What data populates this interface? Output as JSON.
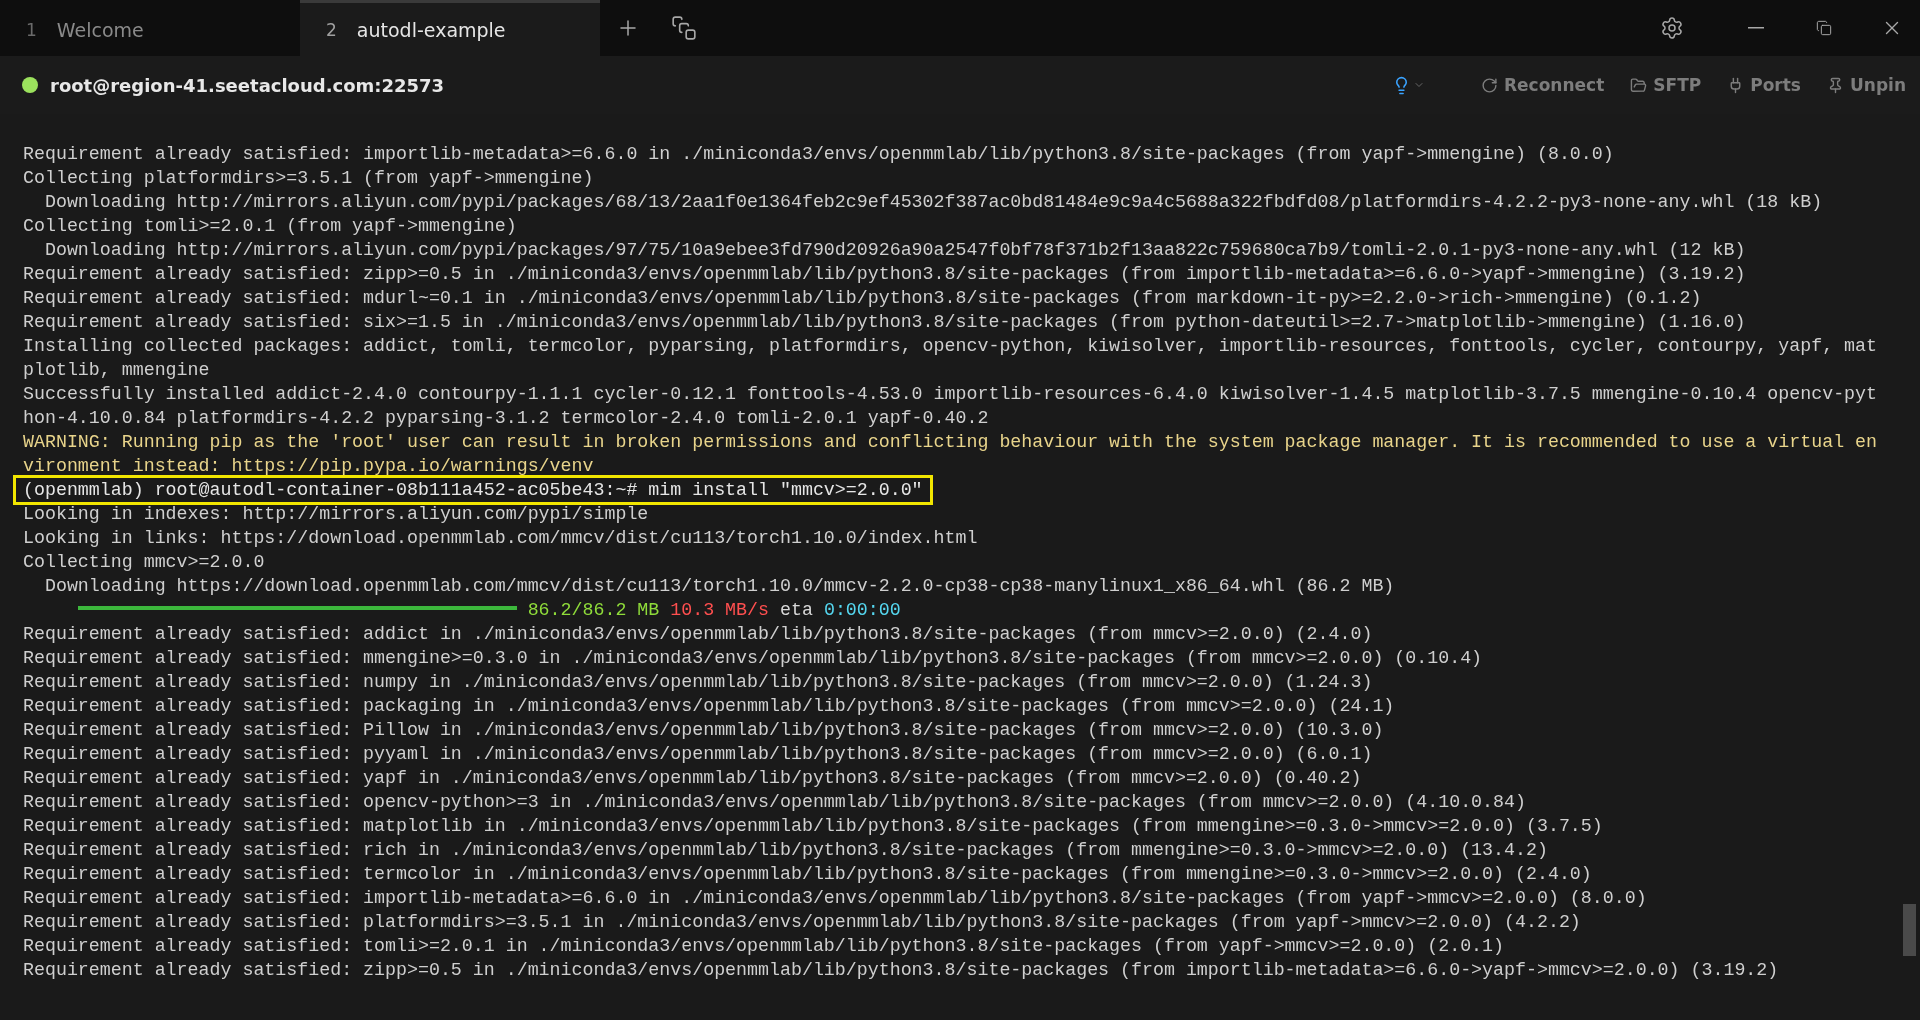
{
  "tabs": [
    {
      "number": "1",
      "label": "Welcome",
      "selected": false
    },
    {
      "number": "2",
      "label": "autodl-example",
      "selected": true
    }
  ],
  "session": {
    "connected": true,
    "host": "root@region-41.seetacloud.com:22573"
  },
  "actions": [
    {
      "kind": "reconnect",
      "label": "Reconnect"
    },
    {
      "kind": "sftp",
      "label": "SFTP"
    },
    {
      "kind": "ports",
      "label": "Ports"
    },
    {
      "kind": "unpin",
      "label": "Unpin"
    }
  ],
  "lines": [
    {
      "kind": "normal",
      "text": "Requirement already satisfied: importlib-metadata>=6.6.0 in ./miniconda3/envs/openmmlab/lib/python3.8/site-packages (from yapf->mmengine) (8.0.0)"
    },
    {
      "kind": "normal",
      "text": "Collecting platformdirs>=3.5.1 (from yapf->mmengine)"
    },
    {
      "kind": "normal",
      "text": "  Downloading http://mirrors.aliyun.com/pypi/packages/68/13/2aa1f0e1364feb2c9ef45302f387ac0bd81484e9c9a4c5688a322fbdfd08/platformdirs-4.2.2-py3-none-any.whl (18 kB)"
    },
    {
      "kind": "normal",
      "text": "Collecting tomli>=2.0.1 (from yapf->mmengine)"
    },
    {
      "kind": "normal",
      "text": "  Downloading http://mirrors.aliyun.com/pypi/packages/97/75/10a9ebee3fd790d20926a90a2547f0bf78f371b2f13aa822c759680ca7b9/tomli-2.0.1-py3-none-any.whl (12 kB)"
    },
    {
      "kind": "normal",
      "text": "Requirement already satisfied: zipp>=0.5 in ./miniconda3/envs/openmmlab/lib/python3.8/site-packages (from importlib-metadata>=6.6.0->yapf->mmengine) (3.19.2)"
    },
    {
      "kind": "normal",
      "text": "Requirement already satisfied: mdurl~=0.1 in ./miniconda3/envs/openmmlab/lib/python3.8/site-packages (from markdown-it-py>=2.2.0->rich->mmengine) (0.1.2)"
    },
    {
      "kind": "normal",
      "text": "Requirement already satisfied: six>=1.5 in ./miniconda3/envs/openmmlab/lib/python3.8/site-packages (from python-dateutil>=2.7->matplotlib->mmengine) (1.16.0)"
    },
    {
      "kind": "normal",
      "text": "Installing collected packages: addict, tomli, termcolor, pyparsing, platformdirs, opencv-python, kiwisolver, importlib-resources, fonttools, cycler, contourpy, yapf, mat"
    },
    {
      "kind": "normal",
      "text": "plotlib, mmengine"
    },
    {
      "kind": "normal",
      "text": "Successfully installed addict-2.4.0 contourpy-1.1.1 cycler-0.12.1 fonttools-4.53.0 importlib-resources-6.4.0 kiwisolver-1.4.5 matplotlib-3.7.5 mmengine-0.10.4 opencv-pyt"
    },
    {
      "kind": "normal",
      "text": "hon-4.10.0.84 platformdirs-4.2.2 pyparsing-3.1.2 termcolor-2.4.0 tomli-2.0.1 yapf-0.40.2"
    },
    {
      "kind": "warning",
      "text": "WARNING: Running pip as the 'root' user can result in broken permissions and conflicting behaviour with the system package manager. It is recommended to use a virtual en"
    },
    {
      "kind": "warning",
      "text": "vironment instead: https://pip.pypa.io/warnings/venv"
    },
    {
      "kind": "command",
      "text": "(openmmlab) root@autodl-container-08b111a452-ac05be43:~# mim install \"mmcv>=2.0.0\""
    },
    {
      "kind": "normal",
      "text": "Looking in indexes: http://mirrors.aliyun.com/pypi/simple"
    },
    {
      "kind": "normal",
      "text": "Looking in links: https://download.openmmlab.com/mmcv/dist/cu113/torch1.10.0/index.html"
    },
    {
      "kind": "normal",
      "text": "Collecting mmcv>=2.0.0"
    },
    {
      "kind": "normal",
      "text": "  Downloading https://download.openmmlab.com/mmcv/dist/cu113/torch1.10.0/mmcv-2.2.0-cp38-cp38-manylinux1_x86_64.whl (86.2 MB)"
    },
    {
      "kind": "progress",
      "level": 1,
      "size": "86.2/86.2 MB",
      "speed": "10.3 MB/s",
      "eta_label": "eta",
      "eta": "0:00:00"
    },
    {
      "kind": "normal",
      "text": "Requirement already satisfied: addict in ./miniconda3/envs/openmmlab/lib/python3.8/site-packages (from mmcv>=2.0.0) (2.4.0)"
    },
    {
      "kind": "normal",
      "text": "Requirement already satisfied: mmengine>=0.3.0 in ./miniconda3/envs/openmmlab/lib/python3.8/site-packages (from mmcv>=2.0.0) (0.10.4)"
    },
    {
      "kind": "normal",
      "text": "Requirement already satisfied: numpy in ./miniconda3/envs/openmmlab/lib/python3.8/site-packages (from mmcv>=2.0.0) (1.24.3)"
    },
    {
      "kind": "normal",
      "text": "Requirement already satisfied: packaging in ./miniconda3/envs/openmmlab/lib/python3.8/site-packages (from mmcv>=2.0.0) (24.1)"
    },
    {
      "kind": "normal",
      "text": "Requirement already satisfied: Pillow in ./miniconda3/envs/openmmlab/lib/python3.8/site-packages (from mmcv>=2.0.0) (10.3.0)"
    },
    {
      "kind": "normal",
      "text": "Requirement already satisfied: pyyaml in ./miniconda3/envs/openmmlab/lib/python3.8/site-packages (from mmcv>=2.0.0) (6.0.1)"
    },
    {
      "kind": "normal",
      "text": "Requirement already satisfied: yapf in ./miniconda3/envs/openmmlab/lib/python3.8/site-packages (from mmcv>=2.0.0) (0.40.2)"
    },
    {
      "kind": "normal",
      "text": "Requirement already satisfied: opencv-python>=3 in ./miniconda3/envs/openmmlab/lib/python3.8/site-packages (from mmcv>=2.0.0) (4.10.0.84)"
    },
    {
      "kind": "normal",
      "text": "Requirement already satisfied: matplotlib in ./miniconda3/envs/openmmlab/lib/python3.8/site-packages (from mmengine>=0.3.0->mmcv>=2.0.0) (3.7.5)"
    },
    {
      "kind": "normal",
      "text": "Requirement already satisfied: rich in ./miniconda3/envs/openmmlab/lib/python3.8/site-packages (from mmengine>=0.3.0->mmcv>=2.0.0) (13.4.2)"
    },
    {
      "kind": "normal",
      "text": "Requirement already satisfied: termcolor in ./miniconda3/envs/openmmlab/lib/python3.8/site-packages (from mmengine>=0.3.0->mmcv>=2.0.0) (2.4.0)"
    },
    {
      "kind": "normal",
      "text": "Requirement already satisfied: importlib-metadata>=6.6.0 in ./miniconda3/envs/openmmlab/lib/python3.8/site-packages (from yapf->mmcv>=2.0.0) (8.0.0)"
    },
    {
      "kind": "normal",
      "text": "Requirement already satisfied: platformdirs>=3.5.1 in ./miniconda3/envs/openmmlab/lib/python3.8/site-packages (from yapf->mmcv>=2.0.0) (4.2.2)"
    },
    {
      "kind": "normal",
      "text": "Requirement already satisfied: tomli>=2.0.1 in ./miniconda3/envs/openmmlab/lib/python3.8/site-packages (from yapf->mmcv>=2.0.0) (2.0.1)"
    },
    {
      "kind": "normal",
      "text": "Requirement already satisfied: zipp>=0.5 in ./miniconda3/envs/openmmlab/lib/python3.8/site-packages (from importlib-metadata>=6.6.0->yapf->mmcv>=2.0.0) (3.19.2)"
    }
  ]
}
